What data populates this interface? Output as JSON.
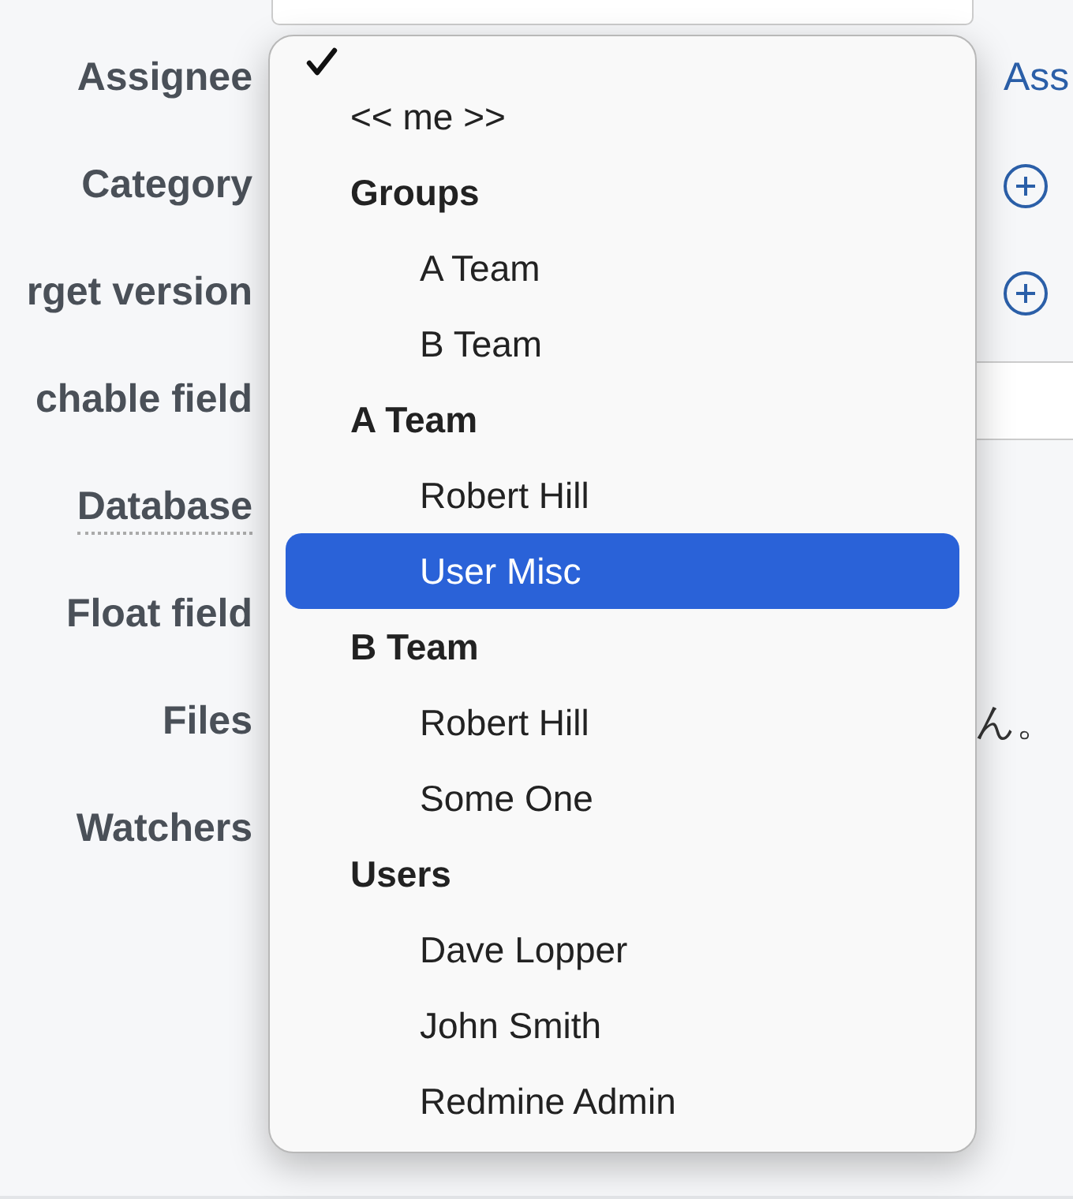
{
  "form": {
    "fields": [
      {
        "label": "Assignee",
        "dotted": false,
        "extra": {
          "kind": "link",
          "text": "Ass"
        }
      },
      {
        "label": "Category",
        "dotted": false,
        "extra": {
          "kind": "add"
        }
      },
      {
        "label": "rget version",
        "dotted": false,
        "extra": {
          "kind": "add"
        }
      },
      {
        "label": "chable field",
        "dotted": false,
        "extra": {
          "kind": "input"
        }
      },
      {
        "label": "Database",
        "dotted": true
      },
      {
        "label": "Float field",
        "dotted": false
      },
      {
        "label": "Files",
        "dotted": false,
        "extra": {
          "kind": "text",
          "text": "ん。"
        }
      },
      {
        "label": "Watchers",
        "dotted": false
      }
    ]
  },
  "dropdown": {
    "options": [
      {
        "kind": "option",
        "checked": true,
        "selected": false
      },
      {
        "kind": "option",
        "label": "<< me >>",
        "checked": false,
        "selected": false
      },
      {
        "kind": "group",
        "label": "Groups",
        "children": [
          {
            "kind": "option",
            "label": "A Team",
            "checked": false,
            "selected": false
          },
          {
            "kind": "option",
            "label": "B Team",
            "checked": false,
            "selected": false
          }
        ]
      },
      {
        "kind": "group",
        "label": "A Team",
        "children": [
          {
            "kind": "option",
            "label": "Robert Hill",
            "checked": false,
            "selected": false
          },
          {
            "kind": "option",
            "label": "User Misc",
            "checked": false,
            "selected": true
          }
        ]
      },
      {
        "kind": "group",
        "label": "B Team",
        "children": [
          {
            "kind": "option",
            "label": "Robert Hill",
            "checked": false,
            "selected": false
          },
          {
            "kind": "option",
            "label": "Some One",
            "checked": false,
            "selected": false
          }
        ]
      },
      {
        "kind": "group",
        "label": "Users",
        "children": [
          {
            "kind": "option",
            "label": "Dave Lopper",
            "checked": false,
            "selected": false
          },
          {
            "kind": "option",
            "label": "John Smith",
            "checked": false,
            "selected": false
          },
          {
            "kind": "option",
            "label": "Redmine Admin",
            "checked": false,
            "selected": false
          }
        ]
      }
    ]
  }
}
